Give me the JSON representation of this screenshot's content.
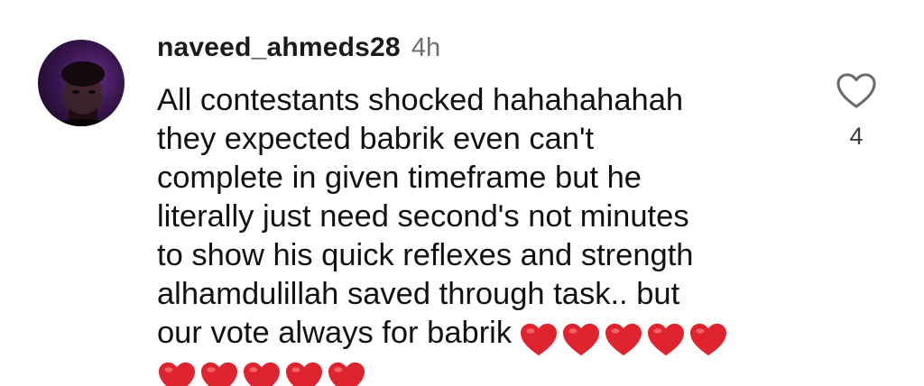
{
  "comment": {
    "username": "naveed_ahmeds28",
    "time": "4h",
    "lines": [
      "All contestants shocked hahahahahah",
      "they expected babrik even can't",
      "complete in given timeframe but he",
      "literally just need second's not minutes",
      "to show his quick reflexes and strength",
      "alhamdulillah saved through task.. but",
      "our vote always for babrik"
    ],
    "heart_emoji_count_line": 5,
    "heart_emoji_count_last_row": 5,
    "heart_color": "#e0242f",
    "avatar_icon": "user-avatar-photo"
  },
  "like": {
    "icon": "heart-outline-icon",
    "count": "4"
  }
}
